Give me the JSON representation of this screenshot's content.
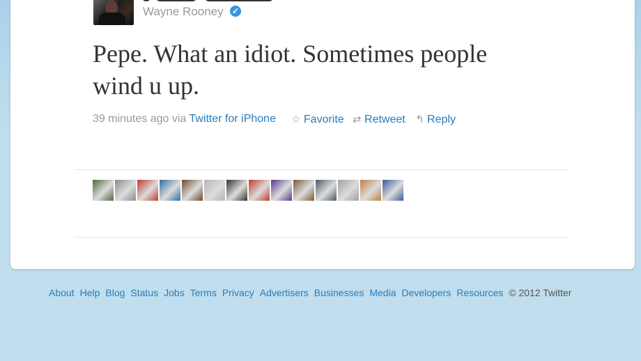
{
  "tweet": {
    "author_name": "Wayne Rooney",
    "verified_badge": "✓",
    "text_line1": "Pepe. What an idiot. Sometimes people",
    "text_line2": "wind u up.",
    "time_ago": "39 minutes ago",
    "via": "via",
    "source": "Twitter for iPhone",
    "actions": {
      "favorite": "Favorite",
      "retweet": "Retweet",
      "reply": "Reply"
    },
    "icons": {
      "favorite": "star-icon",
      "retweet": "retweet-icon",
      "reply": "reply-icon"
    }
  },
  "favorited_by": {
    "count_shown": 14,
    "thumbnail_colors": [
      "#4a6a3a",
      "#8a8a8a",
      "#c0392b",
      "#2e6da4",
      "#6b4a2a",
      "#b5b5b5",
      "#333333",
      "#c23a2a",
      "#5a3a8a",
      "#7a5a3a",
      "#4a5a6a",
      "#a0a0a0",
      "#c08040",
      "#3a5a9a"
    ]
  },
  "footer": {
    "links": [
      "About",
      "Help",
      "Blog",
      "Status",
      "Jobs",
      "Terms",
      "Privacy",
      "Advertisers",
      "Businesses",
      "Media",
      "Developers",
      "Resources"
    ],
    "copyright": "© 2012 Twitter"
  },
  "colors": {
    "link": "#2b7bb9",
    "background": "#c0deed",
    "muted": "#999999"
  }
}
